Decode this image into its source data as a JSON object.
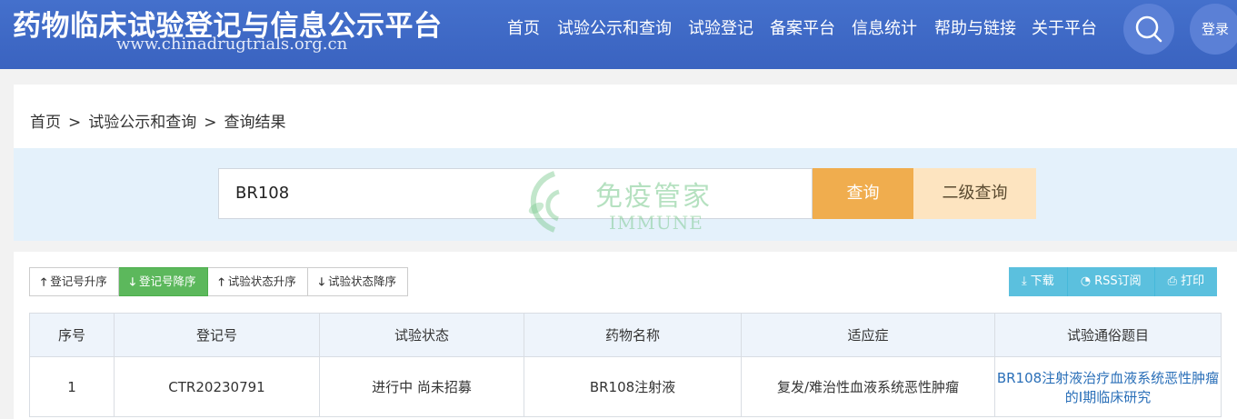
{
  "header": {
    "site_title": "药物临床试验登记与信息公示平台",
    "site_url": "www.chinadrugtrials.org.cn",
    "nav": [
      "首页",
      "试验公示和查询",
      "试验登记",
      "备案平台",
      "信息统计",
      "帮助与链接",
      "关于平台"
    ],
    "login_label": "登录",
    "search_icon": "search-icon"
  },
  "breadcrumb": {
    "items": [
      "首页",
      "试验公示和查询",
      "查询结果"
    ],
    "separator": ">"
  },
  "search": {
    "value": "BR108",
    "query_label": "查询",
    "advanced_label": "二级查询"
  },
  "watermark": {
    "text": "免疫管家",
    "sub": "IMMUNE"
  },
  "sort_buttons": [
    {
      "label": "登记号升序",
      "icon": "arrow-up-icon",
      "active": false
    },
    {
      "label": "登记号降序",
      "icon": "arrow-down-icon",
      "active": true
    },
    {
      "label": "试验状态升序",
      "icon": "arrow-up-icon",
      "active": false
    },
    {
      "label": "试验状态降序",
      "icon": "arrow-down-icon",
      "active": false
    }
  ],
  "tool_buttons": [
    {
      "label": "下载",
      "icon": "download-icon"
    },
    {
      "label": "RSS订阅",
      "icon": "rss-icon"
    },
    {
      "label": "打印",
      "icon": "print-icon"
    }
  ],
  "table": {
    "columns": [
      "序号",
      "登记号",
      "试验状态",
      "药物名称",
      "适应症",
      "试验通俗题目"
    ],
    "rows": [
      [
        "1",
        "CTR20230791",
        "进行中 尚未招募",
        "BR108注射液",
        "复发/难治性血液系统恶性肿瘤",
        "BR108注射液治疗血液系统恶性肿瘤的I期临床研究"
      ]
    ]
  },
  "colors": {
    "header_bg": "#3f69c6",
    "query_button": "#f0ad4e",
    "advanced_button": "#fde4c0",
    "active_sort": "#5cb85c",
    "tool_button": "#5bc0de",
    "link": "#2a6fb8"
  }
}
